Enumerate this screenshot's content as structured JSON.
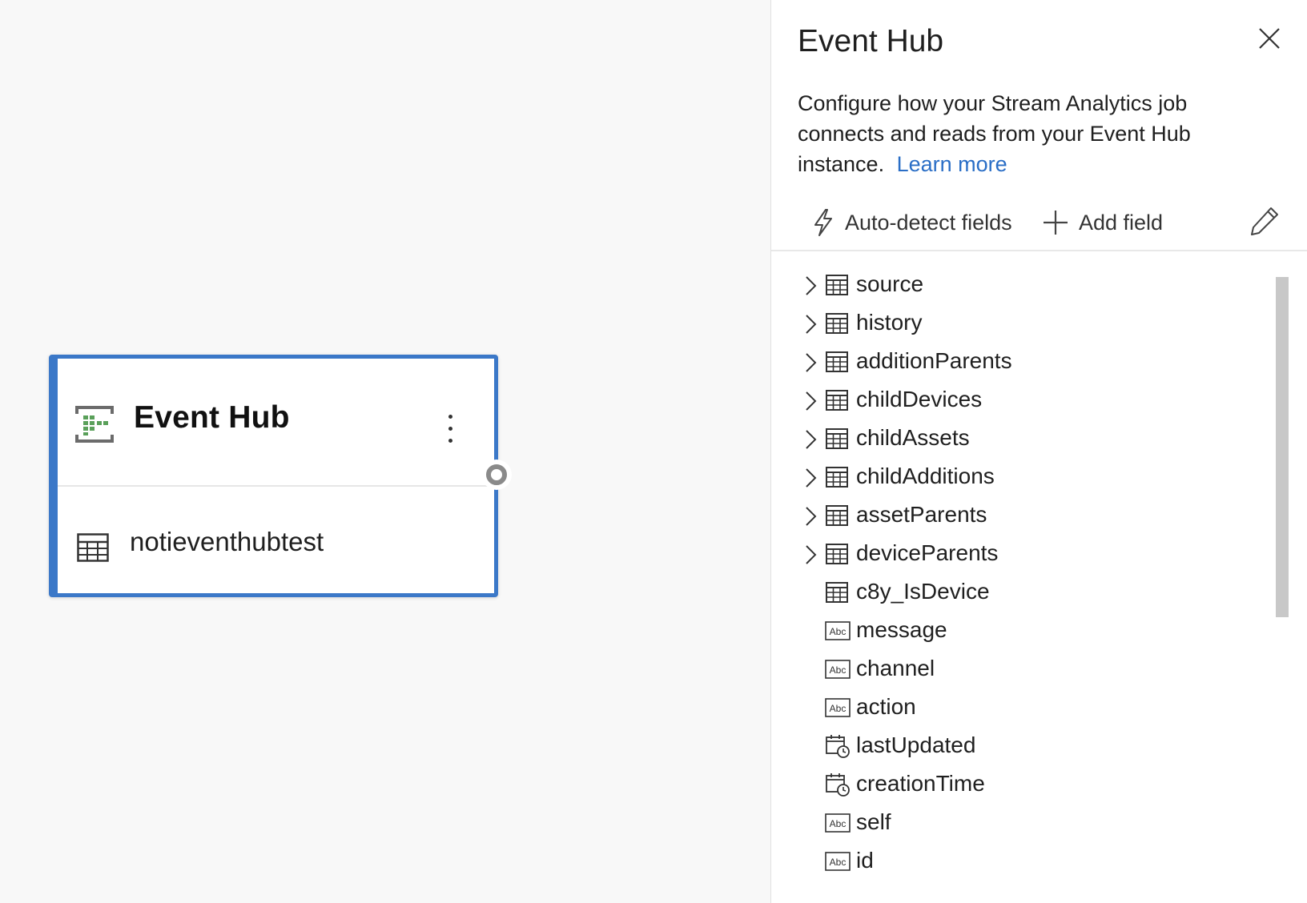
{
  "node": {
    "title": "Event Hub",
    "source_name": "notieventhubtest",
    "icon": "event-hub-icon",
    "menu_icon": "more-vertical-icon",
    "border_color": "#3b78c8"
  },
  "panel": {
    "title": "Event Hub",
    "description": "Configure how your Stream Analytics job connects and reads from your Event Hub instance.",
    "learn_more": "Learn more",
    "close_icon": "close-icon",
    "toolbar": {
      "auto_detect_label": "Auto-detect fields",
      "add_field_label": "Add field",
      "edit_icon": "pencil-icon"
    },
    "fields": [
      {
        "name": "source",
        "type": "record",
        "expandable": true
      },
      {
        "name": "history",
        "type": "record",
        "expandable": true
      },
      {
        "name": "additionParents",
        "type": "record",
        "expandable": true
      },
      {
        "name": "childDevices",
        "type": "record",
        "expandable": true
      },
      {
        "name": "childAssets",
        "type": "record",
        "expandable": true
      },
      {
        "name": "childAdditions",
        "type": "record",
        "expandable": true
      },
      {
        "name": "assetParents",
        "type": "record",
        "expandable": true
      },
      {
        "name": "deviceParents",
        "type": "record",
        "expandable": true
      },
      {
        "name": "c8y_IsDevice",
        "type": "record",
        "expandable": false
      },
      {
        "name": "message",
        "type": "string",
        "expandable": false
      },
      {
        "name": "channel",
        "type": "string",
        "expandable": false
      },
      {
        "name": "action",
        "type": "string",
        "expandable": false
      },
      {
        "name": "lastUpdated",
        "type": "datetime",
        "expandable": false
      },
      {
        "name": "creationTime",
        "type": "datetime",
        "expandable": false
      },
      {
        "name": "self",
        "type": "string",
        "expandable": false
      },
      {
        "name": "id",
        "type": "string",
        "expandable": false
      }
    ]
  },
  "colors": {
    "accent": "#3b78c8",
    "link": "#2a6ec6",
    "event_hub_green": "#5aa05a"
  }
}
